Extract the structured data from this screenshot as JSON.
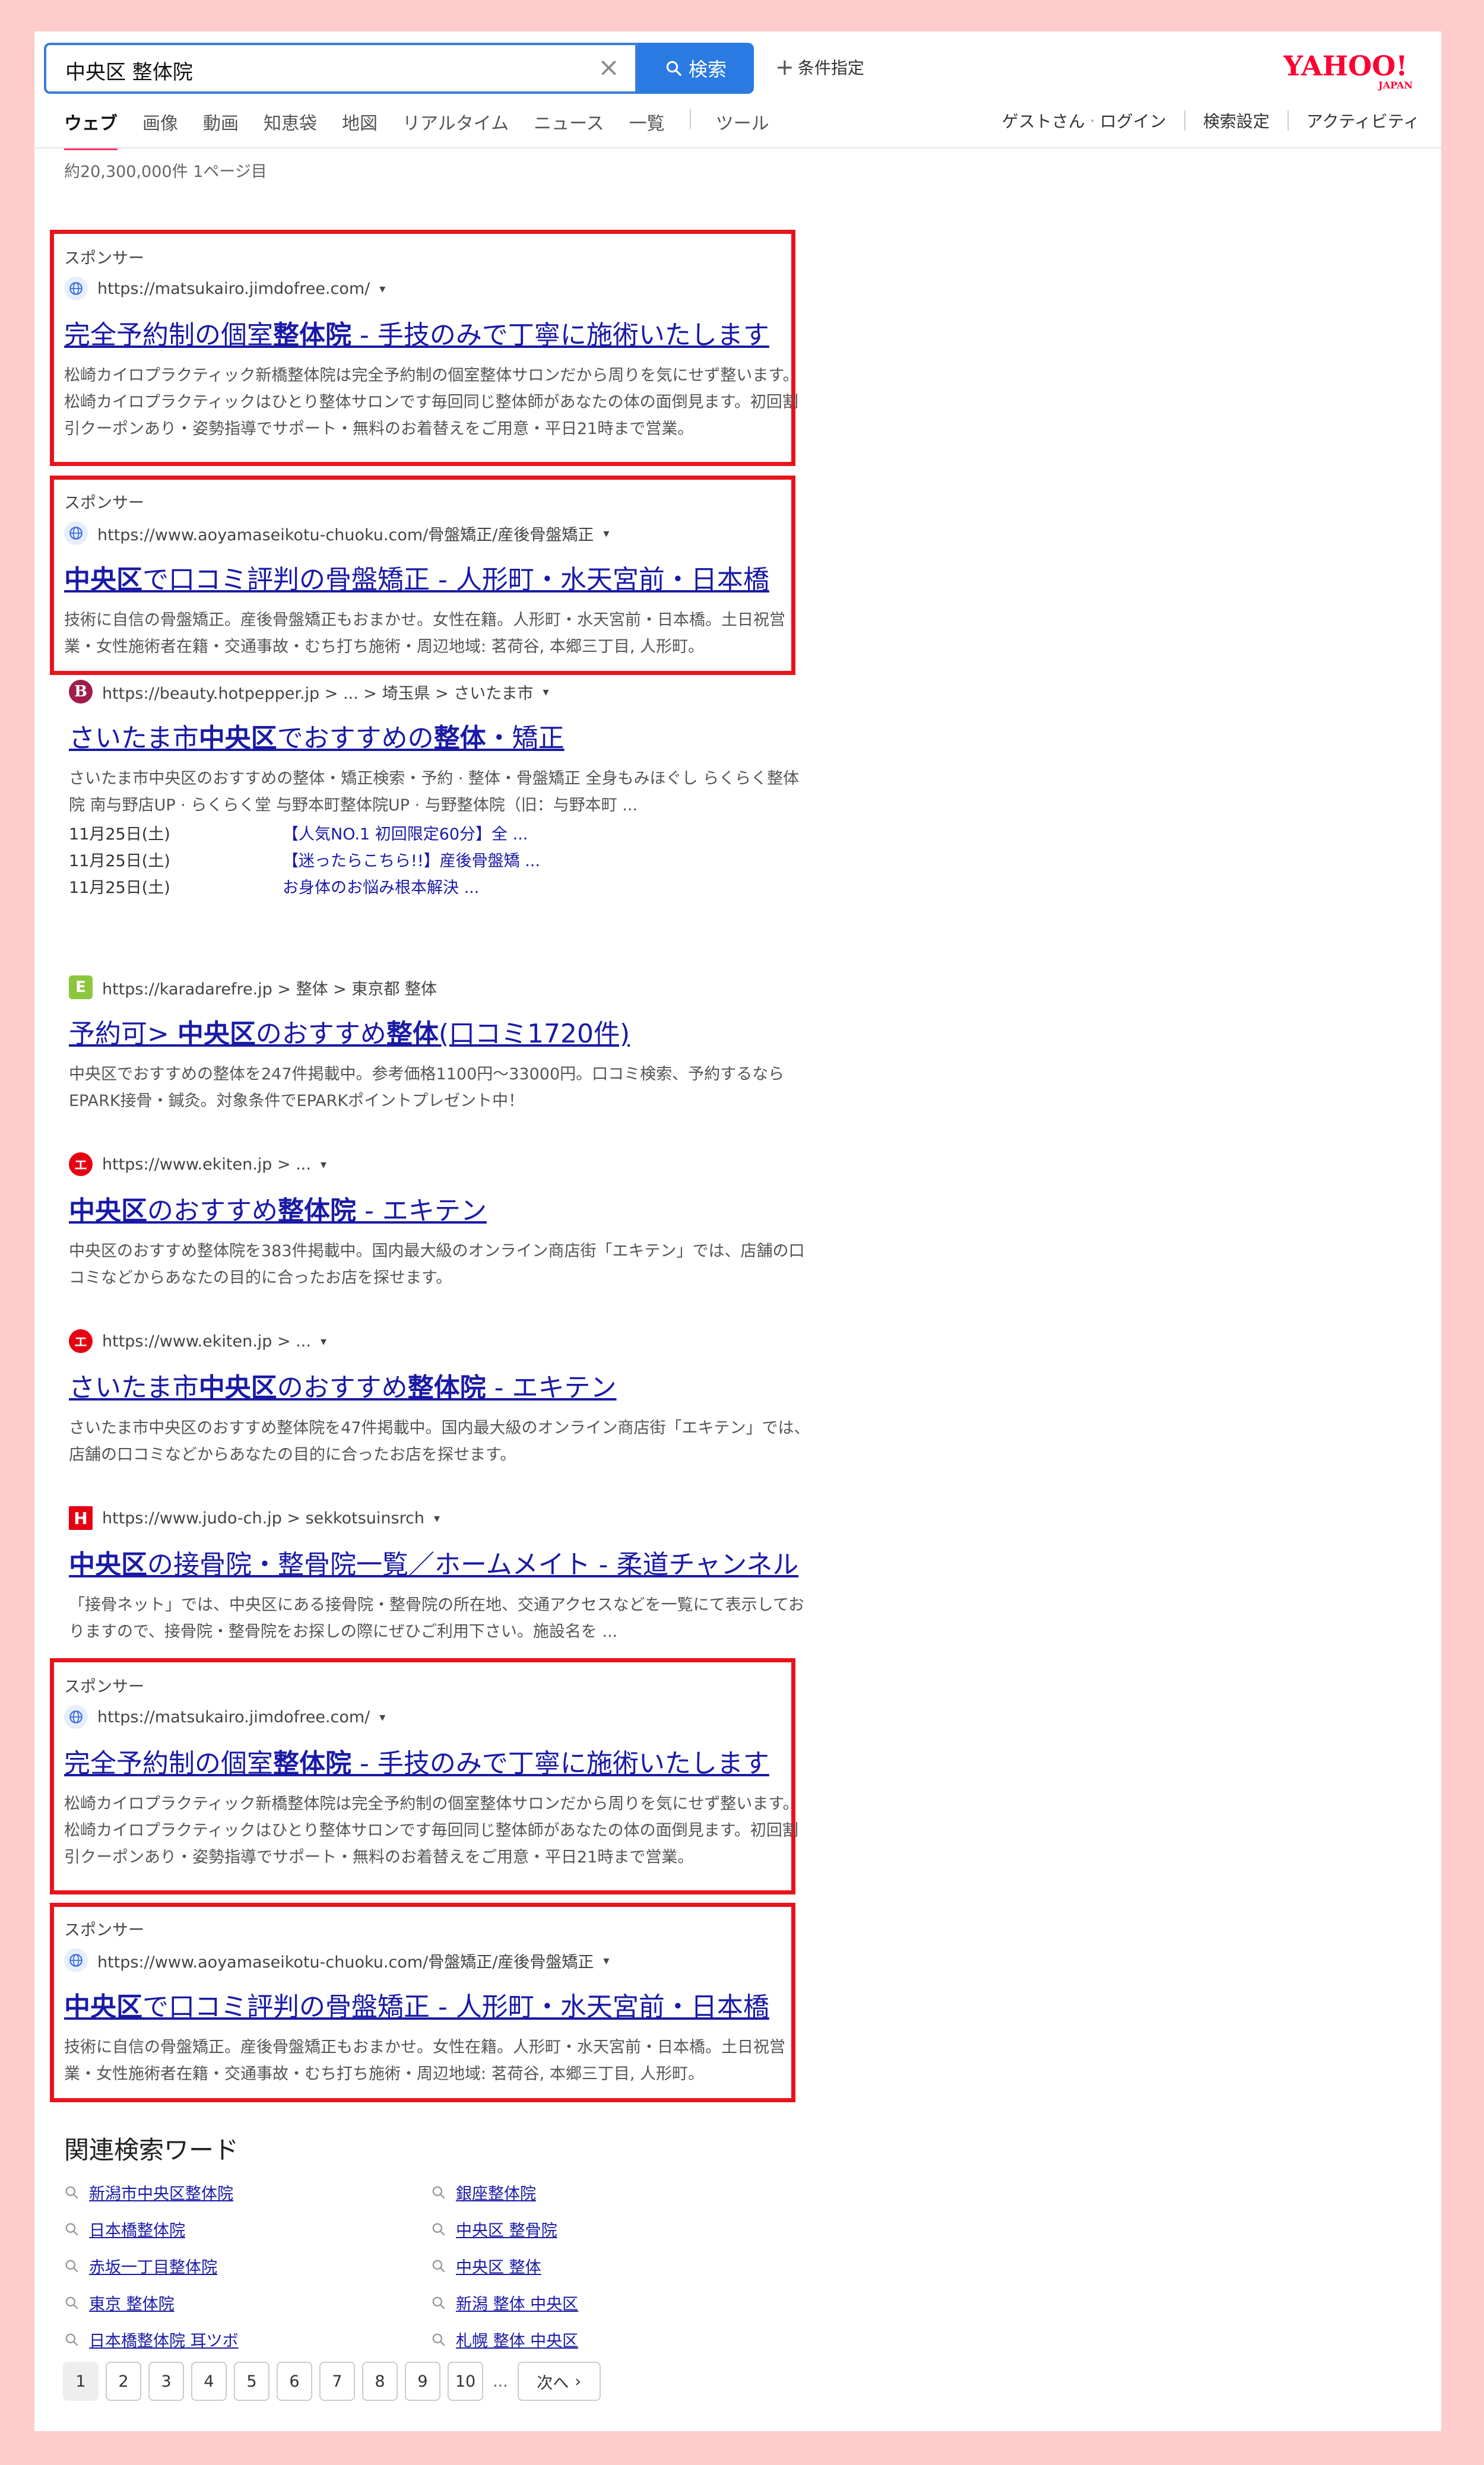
{
  "search": {
    "query": "中央区 整体院",
    "button_label": "検索",
    "conditions_label": "条件指定"
  },
  "logo": {
    "main": "YAHOO!",
    "sub": "JAPAN"
  },
  "tabs": [
    "ウェブ",
    "画像",
    "動画",
    "知恵袋",
    "地図",
    "リアルタイム",
    "ニュース",
    "一覧",
    "ツール"
  ],
  "user": {
    "guest": "ゲストさん",
    "login": "ログイン",
    "settings": "検索設定",
    "activity": "アクティビティ"
  },
  "result_count": "約20,300,000件  1ページ目",
  "results": [
    {
      "sponsor": "スポンサー",
      "url": "https://matsukairo.jimdofree.com/",
      "title_pre": "完全予約制の個室",
      "title_bold": "整体院",
      "title_post": " - 手技のみで丁寧に施術いたします",
      "desc": "松崎カイロプラクティック新橋整体院は完全予約制の個室整体サロンだから周りを気にせず整います。松崎カイロプラクティックはひとり整体サロンです毎回同じ整体師があなたの体の面倒見ます。初回割引クーポンあり・姿勢指導でサポート・無料のお着替えをご用意・平日21時まで営業。"
    },
    {
      "sponsor": "スポンサー",
      "url": "https://www.aoyamaseikotu-chuoku.com/骨盤矯正/産後骨盤矯正",
      "title_bold": "中央区",
      "title_post": "で口コミ評判の骨盤矯正 - 人形町・水天宮前・日本橋",
      "desc": "技術に自信の骨盤矯正。産後骨盤矯正もおまかせ。女性在籍。人形町・水天宮前・日本橋。土日祝営業・女性施術者在籍・交通事故・むち打ち施術・周辺地域: 茗荷谷, 本郷三丁目, 人形町。"
    },
    {
      "url": "https://beauty.hotpepper.jp > ... > 埼玉県 > さいたま市",
      "title_pre": "さいたま市",
      "title_bold": "中央区",
      "title_mid": "でおすすめの",
      "title_bold2": "整体",
      "title_post": "・矯正",
      "desc": "さいたま市中央区のおすすめの整体・矯正検索・予約 · 整体・骨盤矯正 全身もみほぐし らくらく整体院 南与野店UP · らくらく堂 与野本町整体院UP · 与野整体院（旧：与野本町 ...",
      "sub": [
        {
          "date": "11月25日(土)",
          "link": "【人気NO.1 初回限定60分】全 ..."
        },
        {
          "date": "11月25日(土)",
          "link": "【迷ったらこちら!!】産後骨盤矯 ..."
        },
        {
          "date": "11月25日(土)",
          "link": "お身体のお悩み根本解決 ..."
        }
      ]
    },
    {
      "url": "https://karadarefre.jp > 整体 > 東京都 整体",
      "title_pre": "予約可> ",
      "title_bold": "中央区",
      "title_mid": "のおすすめ",
      "title_bold2": "整体",
      "title_post": "(口コミ1720件)",
      "desc": "中央区でおすすめの整体を247件掲載中。参考価格1100円〜33000円。口コミ検索、予約するならEPARK接骨・鍼灸。対象条件でEPARKポイントプレゼント中！"
    },
    {
      "url": "https://www.ekiten.jp > ...",
      "title_bold": "中央区",
      "title_mid": "のおすすめ",
      "title_bold2": "整体院",
      "title_post": " - エキテン",
      "desc": "中央区のおすすめ整体院を383件掲載中。国内最大級のオンライン商店街「エキテン」では、店舗の口コミなどからあなたの目的に合ったお店を探せます。"
    },
    {
      "url": "https://www.ekiten.jp > ...",
      "title_pre": "さいたま市",
      "title_bold": "中央区",
      "title_mid": "のおすすめ",
      "title_bold2": "整体院",
      "title_post": " - エキテン",
      "desc": "さいたま市中央区のおすすめ整体院を47件掲載中。国内最大級のオンライン商店街「エキテン」では、店舗の口コミなどからあなたの目的に合ったお店を探せます。"
    },
    {
      "url": "https://www.judo-ch.jp > sekkotsuinsrch",
      "title_bold": "中央区",
      "title_post": "の接骨院・整骨院一覧／ホームメイト - 柔道チャンネル",
      "desc": "「接骨ネット」では、中央区にある接骨院・整骨院の所在地、交通アクセスなどを一覧にて表示しておりますので、接骨院・整骨院をお探しの際にぜひご利用下さい。施設名を ..."
    },
    {
      "sponsor": "スポンサー",
      "url": "https://matsukairo.jimdofree.com/",
      "title_pre": "完全予約制の個室",
      "title_bold": "整体院",
      "title_post": " - 手技のみで丁寧に施術いたします",
      "desc": "松崎カイロプラクティック新橋整体院は完全予約制の個室整体サロンだから周りを気にせず整います。松崎カイロプラクティックはひとり整体サロンです毎回同じ整体師があなたの体の面倒見ます。初回割引クーポンあり・姿勢指導でサポート・無料のお着替えをご用意・平日21時まで営業。"
    },
    {
      "sponsor": "スポンサー",
      "url": "https://www.aoyamaseikotu-chuoku.com/骨盤矯正/産後骨盤矯正",
      "title_bold": "中央区",
      "title_post": "で口コミ評判の骨盤矯正 - 人形町・水天宮前・日本橋",
      "desc": "技術に自信の骨盤矯正。産後骨盤矯正もおまかせ。女性在籍。人形町・水天宮前・日本橋。土日祝営業・女性施術者在籍・交通事故・むち打ち施術・周辺地域: 茗荷谷, 本郷三丁目, 人形町。"
    }
  ],
  "related": {
    "title": "関連検索ワード",
    "items": [
      "新潟市中央区整体院",
      "銀座整体院",
      "日本橋整体院",
      "中央区 整骨院",
      "赤坂一丁目整体院",
      "中央区 整体",
      "東京 整体院",
      "新潟 整体 中央区",
      "日本橋整体院 耳ツボ",
      "札幌 整体 中央区"
    ]
  },
  "pagination": {
    "pages": [
      "1",
      "2",
      "3",
      "4",
      "5",
      "6",
      "7",
      "8",
      "9",
      "10"
    ],
    "dots": "...",
    "next": "次へ"
  },
  "colors": {
    "ad_border": "#e8141c",
    "link": "#1a1aa6",
    "accent": "#2a7ae2",
    "outer_bg": "#ffcccc"
  }
}
